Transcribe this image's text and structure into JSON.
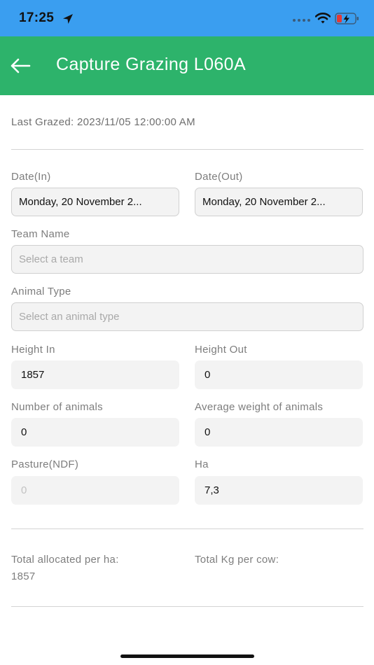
{
  "status_bar": {
    "time": "17:25",
    "icons": [
      "location-arrow-icon",
      "signal-dots-icon",
      "wifi-icon",
      "battery-charging-icon"
    ],
    "background": "#3a9ef0"
  },
  "app_bar": {
    "back_icon": "arrow-left-icon",
    "title": "Capture Grazing L060A",
    "background": "#2db36b"
  },
  "last_grazed": "Last Grazed: 2023/11/05 12:00:00 AM",
  "form": {
    "date_in": {
      "label": "Date(In)",
      "value": "Monday, 20 November 2..."
    },
    "date_out": {
      "label": "Date(Out)",
      "value": "Monday, 20 November 2..."
    },
    "team_name": {
      "label": "Team Name",
      "placeholder": "Select a team"
    },
    "animal_type": {
      "label": "Animal Type",
      "placeholder": "Select an animal type"
    },
    "height_in": {
      "label": "Height In",
      "value": "1857"
    },
    "height_out": {
      "label": "Height Out",
      "value": "0"
    },
    "num_animals": {
      "label": "Number of animals",
      "value": "0"
    },
    "avg_weight": {
      "label": "Average weight of animals",
      "value": "0"
    },
    "pasture_ndf": {
      "label": "Pasture(NDF)",
      "value": "0"
    },
    "ha": {
      "label": "Ha",
      "value": "7,3"
    }
  },
  "summary": {
    "total_allocated_label": "Total allocated per ha:",
    "total_allocated_value": "1857",
    "total_kg_label": "Total Kg per cow:"
  }
}
